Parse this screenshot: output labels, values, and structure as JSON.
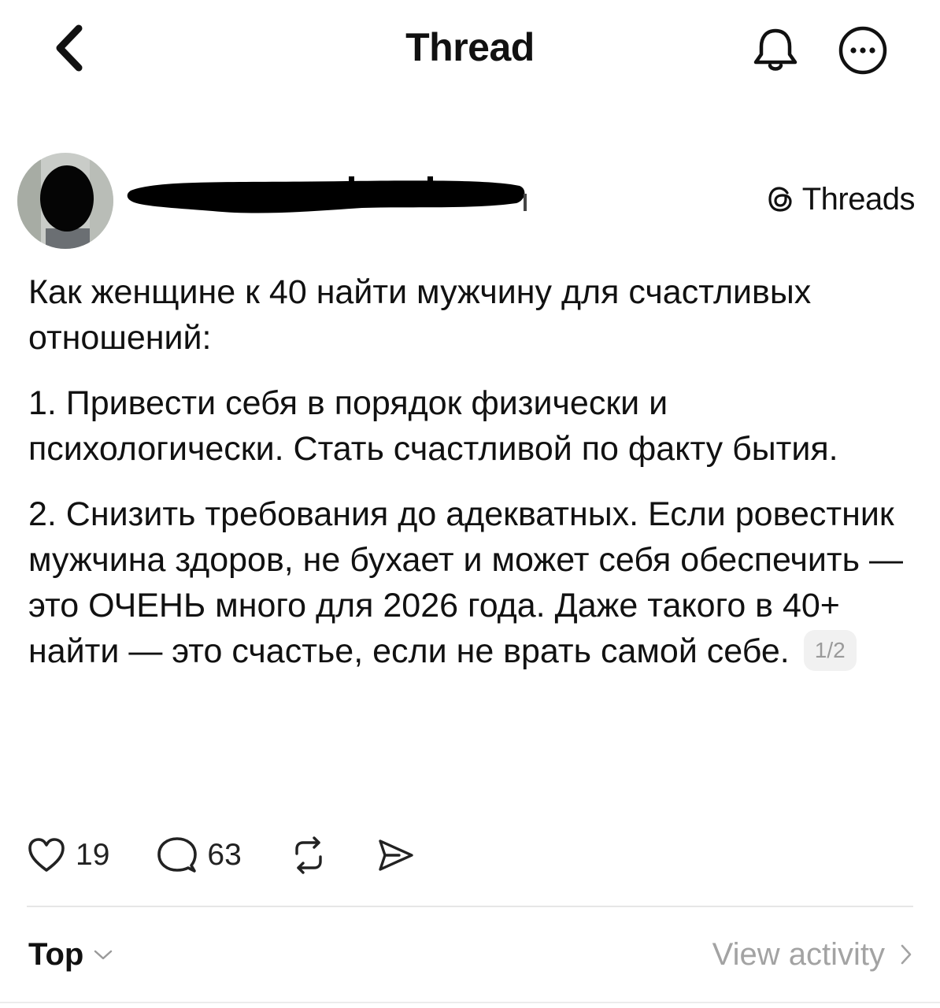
{
  "header": {
    "title": "Thread",
    "back_icon": "chevron-left-icon",
    "bell_icon": "bell-icon",
    "more_icon": "more-icon"
  },
  "author": {
    "avatar_icon": "avatar",
    "badge_label": "Threads",
    "badge_icon": "threads-logo-icon"
  },
  "post": {
    "paragraphs": [
      "Как женщине к 40 найти мужчину для счастливых отношений:",
      "1. Привести себя в порядок физически и психологически. Стать счастливой по факту бытия.",
      "2. Снизить требования до адекватных. Если ровестник мужчина здоров, не бухает и может себя обеспечить — это ОЧЕНЬ много для 2026 года. Даже такого в 40+ найти — это счастье, если не врать самой себе."
    ],
    "page_indicator": "1/2"
  },
  "actions": {
    "likes": "19",
    "replies": "63",
    "like_icon": "heart-icon",
    "reply_icon": "comment-icon",
    "repost_icon": "repost-icon",
    "share_icon": "send-icon"
  },
  "footer": {
    "sort_label": "Top",
    "view_activity_label": "View activity"
  },
  "colors": {
    "text": "#111111",
    "muted": "#a3a3a3",
    "divider": "#e6e6e6",
    "background": "#ffffff"
  }
}
